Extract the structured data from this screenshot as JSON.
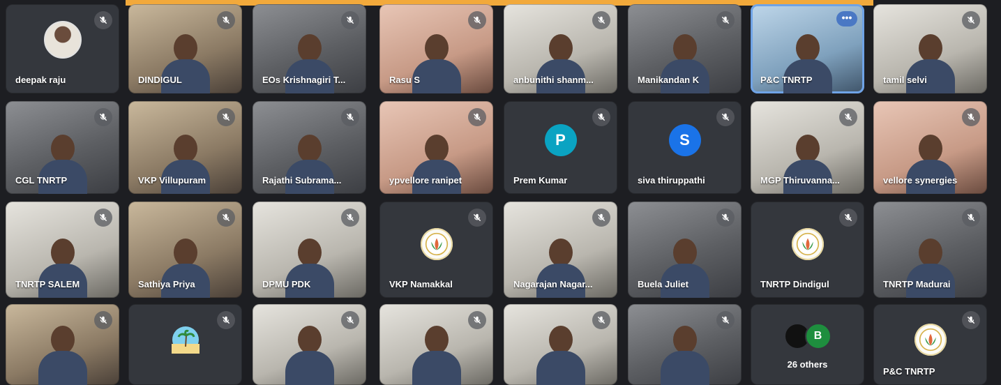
{
  "participants": [
    {
      "name": "deepak raju",
      "kind": "photo"
    },
    {
      "name": "DINDIGUL",
      "kind": "video"
    },
    {
      "name": "EOs Krishnagiri T...",
      "kind": "video"
    },
    {
      "name": "Rasu S",
      "kind": "video"
    },
    {
      "name": "anbunithi shanm...",
      "kind": "video"
    },
    {
      "name": "Manikandan K",
      "kind": "video"
    },
    {
      "name": "P&C TNRTP",
      "kind": "video"
    },
    {
      "name": "tamil selvi",
      "kind": "video"
    },
    {
      "name": "CGL TNRTP",
      "kind": "video"
    },
    {
      "name": "VKP Villupuram",
      "kind": "video"
    },
    {
      "name": "Rajathi Subrama...",
      "kind": "video"
    },
    {
      "name": "ypvellore ranipet",
      "kind": "video"
    },
    {
      "name": "Prem Kumar",
      "kind": "letter",
      "letter": "P",
      "color": "#0aa3c2"
    },
    {
      "name": "siva thiruppathi",
      "kind": "letter",
      "letter": "S",
      "color": "#1a73e8"
    },
    {
      "name": "MGP Thiruvanna...",
      "kind": "video"
    },
    {
      "name": "vellore synergies",
      "kind": "video"
    },
    {
      "name": "TNRTP SALEM",
      "kind": "video"
    },
    {
      "name": "Sathiya Priya",
      "kind": "video"
    },
    {
      "name": "DPMU PDK",
      "kind": "video"
    },
    {
      "name": "VKP Namakkal",
      "kind": "logo"
    },
    {
      "name": "Nagarajan Nagar...",
      "kind": "video"
    },
    {
      "name": "Buela Juliet",
      "kind": "video"
    },
    {
      "name": "TNRTP Dindigul",
      "kind": "logo"
    },
    {
      "name": "TNRTP Madurai",
      "kind": "video"
    },
    {
      "name": "",
      "kind": "video"
    },
    {
      "name": "",
      "kind": "beach"
    },
    {
      "name": "",
      "kind": "video"
    },
    {
      "name": "",
      "kind": "video"
    },
    {
      "name": "",
      "kind": "video"
    },
    {
      "name": "",
      "kind": "video"
    },
    {
      "name": "26 others",
      "kind": "others",
      "letter": "B"
    },
    {
      "name": "P&C TNRTP",
      "kind": "logo"
    }
  ],
  "icons": {
    "mute": "mic-off-icon",
    "more": "more-options-icon"
  },
  "colors": {
    "background": "#1d1e22",
    "banner": "#f2a93b",
    "tile": "#3a3d44",
    "selected": "#6fa3e6"
  }
}
